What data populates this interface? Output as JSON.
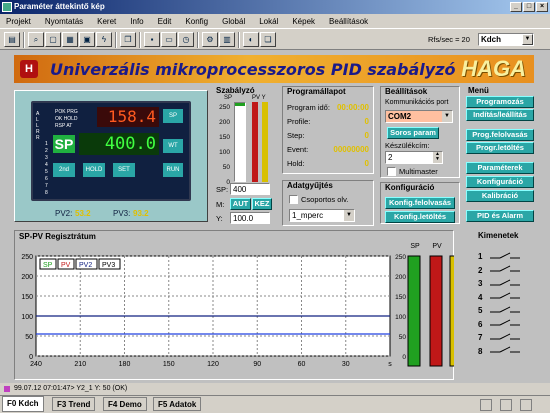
{
  "window": {
    "title": "Paraméter áttekintő kép"
  },
  "menu": [
    "Projekt",
    "Nyomtatás",
    "Keret",
    "Info",
    "Edit",
    "Konfig",
    "Globál",
    "Lokál",
    "Képek",
    "Beállítások"
  ],
  "toolbar": {
    "rfs_label": "Rfs/sec = 20",
    "view_value": "Kdch"
  },
  "banner": {
    "title": "Univerzális mikroprocesszoros PID szabályzó",
    "logo_text": "HAGA",
    "emblem": "H"
  },
  "device": {
    "display_top": "158.4",
    "display_bottom": "400.0",
    "sp_badge": "SP",
    "pv2_label": "PV2:",
    "pv2_value": "53.2",
    "pv3_label": "PV3:",
    "pv3_value": "93.2",
    "leds": [
      "POK",
      "PRG",
      "OK",
      "HOLD",
      "RSP",
      "AT"
    ],
    "side_numbers": [
      "1",
      "2",
      "3",
      "4",
      "5",
      "6",
      "7",
      "8"
    ],
    "side_letters": [
      "A",
      "L",
      "L",
      "R",
      "R"
    ],
    "btn_2nd": "2nd",
    "btn_hold": "HOLD",
    "btn_set": "SET",
    "btn_run": "RUN",
    "btn_sp": "SP",
    "btn_wt": "WT"
  },
  "szabalyzo": {
    "title": "Szabályzó",
    "col_sp": "SP",
    "col_pvy": "PV Y",
    "ticks": [
      "250",
      "200",
      "150",
      "100",
      "50",
      "0"
    ],
    "sp_label": "SP:",
    "sp_value": "400",
    "m_label": "M:",
    "aut_button": "AUT",
    "kez_button": "KEZ",
    "y_label": "Y:",
    "y_value": "100.0"
  },
  "programallapot": {
    "title": "Programállapot",
    "rows": [
      {
        "label": "Program idő:",
        "value": "00:00:00"
      },
      {
        "label": "Profile:",
        "value": "0"
      },
      {
        "label": "Step:",
        "value": "0"
      },
      {
        "label": "Event:",
        "value": "00000000"
      },
      {
        "label": "Hold:",
        "value": "0"
      }
    ]
  },
  "adatgyujtes": {
    "title": "Adatgyűjtés",
    "checkbox_label": "Csoportos olv.",
    "select_value": "1_mperc"
  },
  "beallitasok": {
    "title": "Beállítások",
    "port_label": "Kommunikációs port",
    "port_value": "COM2",
    "soros_button": "Soros param",
    "address_label": "Készülékcím:",
    "address_value": "2",
    "multimaster_label": "Multimaster"
  },
  "konfiguracio": {
    "title": "Konfiguráció",
    "btn_upload": "Konfig.felolvasás",
    "btn_download": "Konfig.letöltés"
  },
  "menu_panel": {
    "title": "Menü",
    "buttons": [
      "Programozás",
      "Indítás/leállítás",
      "Prog.felolvasás",
      "Progr.letöltés",
      "Paraméterek",
      "Konfiguráció",
      "Kalibráció",
      "PID és Alarm"
    ]
  },
  "trend": {
    "title": "SP-PV Regisztrátum",
    "legend": [
      "SP",
      "PV",
      "PV2",
      "PV3"
    ],
    "y_ticks": [
      "250",
      "200",
      "150",
      "100",
      "50",
      "0"
    ],
    "x_ticks": [
      "240",
      "210",
      "180",
      "150",
      "120",
      "90",
      "60",
      "30",
      "s"
    ],
    "bar_labels": [
      "SP",
      "PV",
      "Y"
    ],
    "bar_ticks": [
      "250",
      "200",
      "150",
      "100",
      "50",
      "0"
    ]
  },
  "chart_data": {
    "type": "line",
    "series": [
      {
        "name": "PV",
        "x": [
          240,
          0
        ],
        "values": [
          100,
          100
        ]
      },
      {
        "name": "SP",
        "x": [
          240,
          0
        ],
        "values": [
          55,
          55
        ]
      }
    ],
    "xlim": [
      240,
      0
    ],
    "ylim": [
      0,
      250
    ],
    "grid": true
  },
  "kimenetek": {
    "title": "Kimenetek",
    "outputs": [
      "1",
      "2",
      "3",
      "4",
      "5",
      "6",
      "7",
      "8"
    ]
  },
  "status": {
    "text": "99.07.12 07:01:47> Y2_1    Y:              50        (OK)"
  },
  "tabs": [
    "F0 Kdch",
    "F3 Trend",
    "F4 Demo",
    "F5 Adatok"
  ],
  "colors": {
    "teal": "#2aa6a6",
    "yellow_value": "#e0c000",
    "sp_green": "#20a020",
    "pv_red": "#c01818",
    "y_yellow": "#d8c000"
  }
}
